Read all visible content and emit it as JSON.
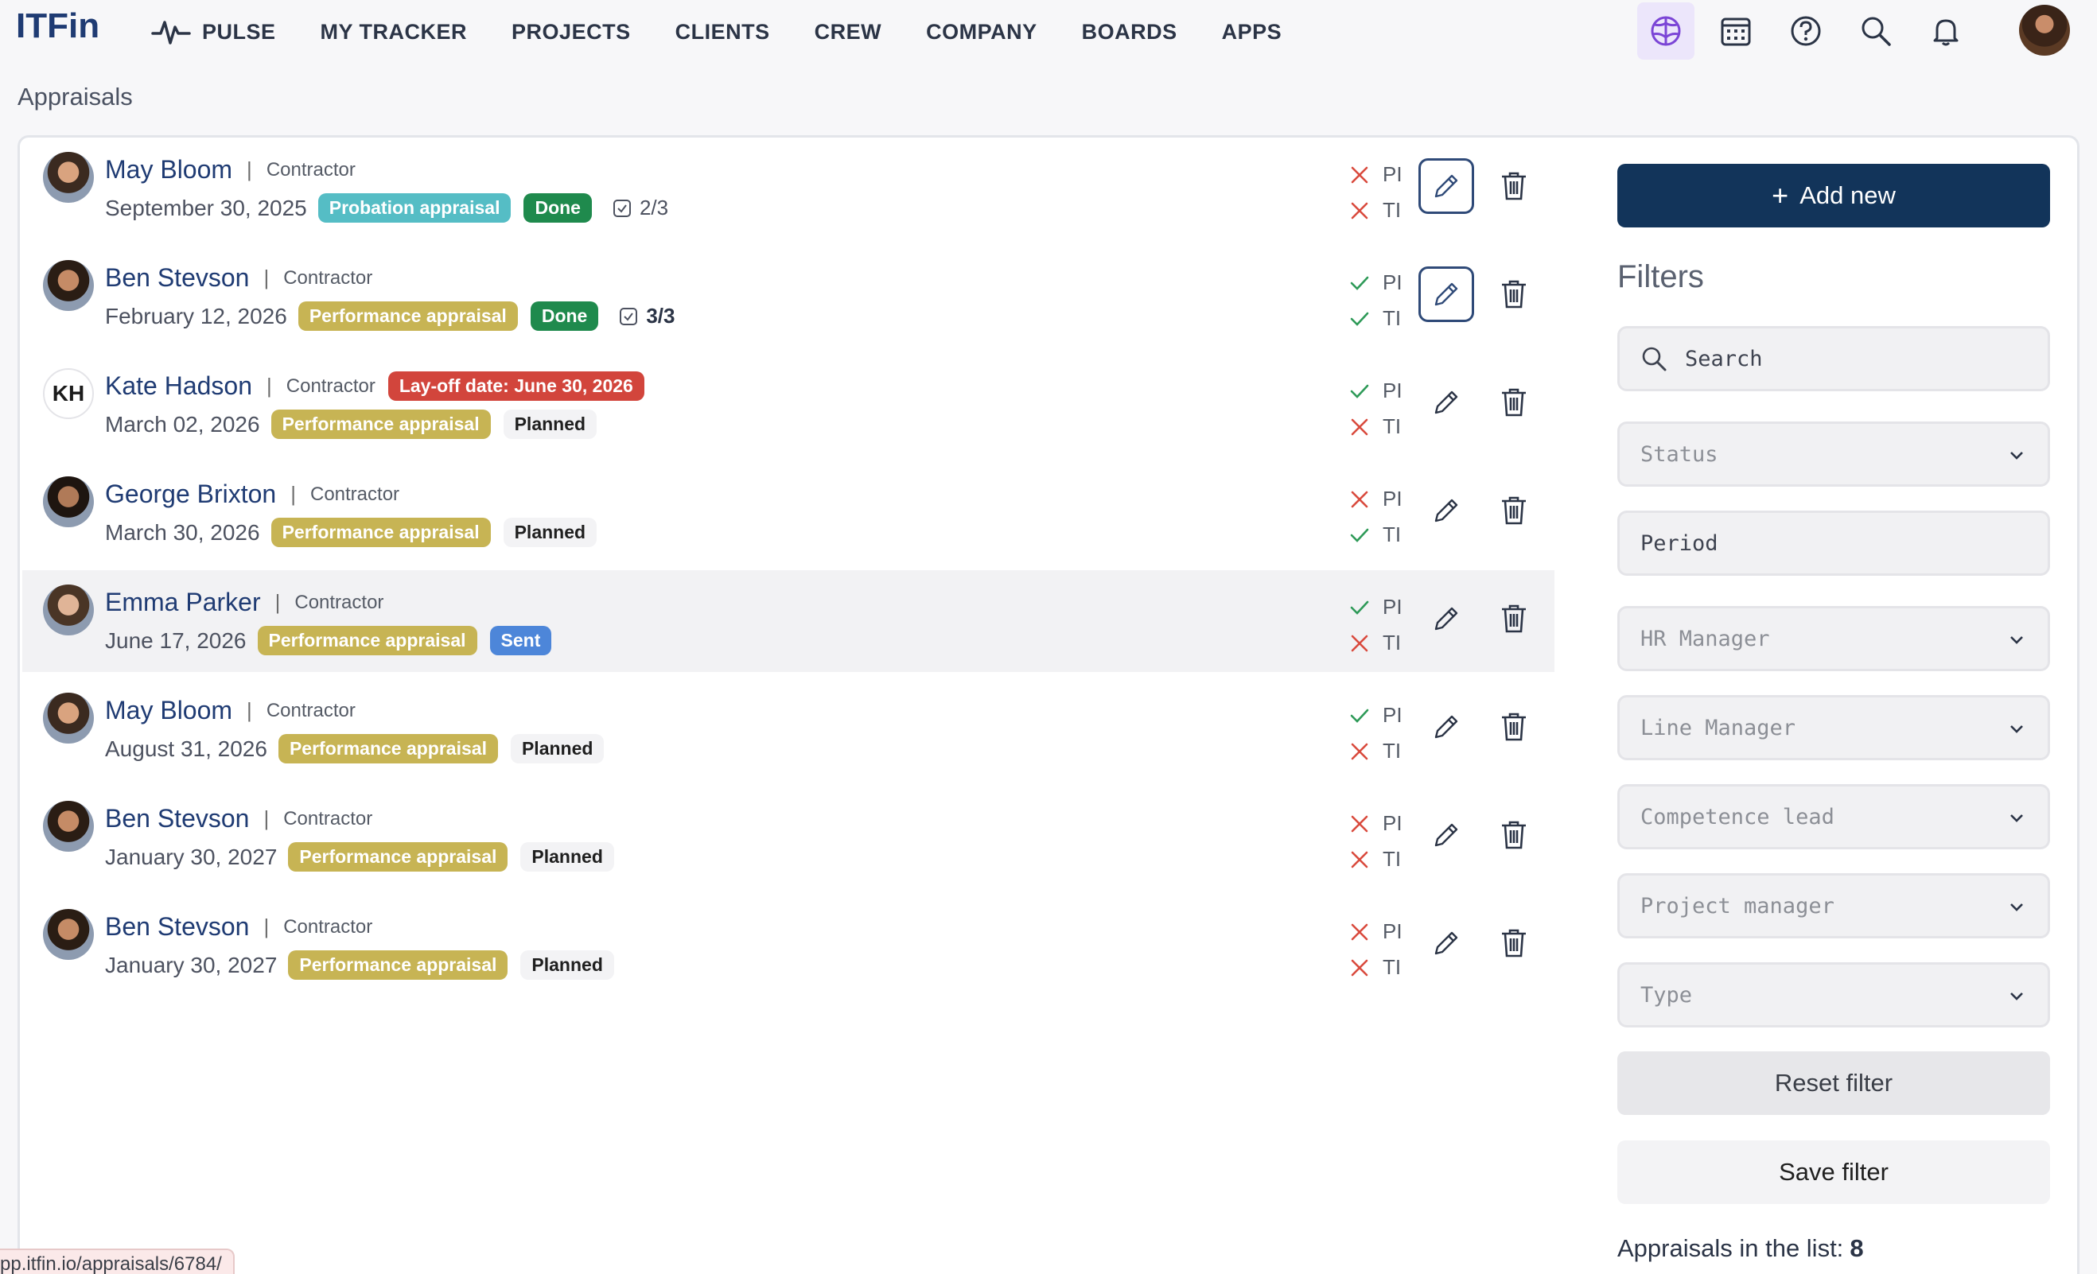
{
  "app": {
    "logo": "ITFin"
  },
  "nav": {
    "items": [
      "PULSE",
      "MY TRACKER",
      "PROJECTS",
      "CLIENTS",
      "CREW",
      "COMPANY",
      "BOARDS",
      "APPS"
    ]
  },
  "top_icons": [
    "brain-icon",
    "calendar-icon",
    "help-icon",
    "search-icon",
    "bell-icon"
  ],
  "page": {
    "title": "Appraisals"
  },
  "appraisals": [
    {
      "name": "May Bloom",
      "role": "Contractor",
      "date": "September 30, 2025",
      "type": "Probation appraisal",
      "type_color": "#55bdc5",
      "status": "Done",
      "tasks": "2/3",
      "pi": false,
      "ti": false,
      "layoff": ""
    },
    {
      "name": "Ben Stevson",
      "role": "Contractor",
      "date": "February 12, 2026",
      "type": "Performance appraisal",
      "type_color": "#c7b454",
      "status": "Done",
      "tasks": "3/3",
      "pi": true,
      "ti": true,
      "layoff": ""
    },
    {
      "name": "Kate Hadson",
      "initials": "KH",
      "role": "Contractor",
      "date": "March 02, 2026",
      "type": "Performance appraisal",
      "type_color": "#c7b454",
      "status": "Planned",
      "tasks": "",
      "pi": true,
      "ti": false,
      "layoff": "Lay-off date: June 30, 2026"
    },
    {
      "name": "George Brixton",
      "role": "Contractor",
      "date": "March 30, 2026",
      "type": "Performance appraisal",
      "type_color": "#c7b454",
      "status": "Planned",
      "tasks": "",
      "pi": false,
      "ti": true,
      "layoff": ""
    },
    {
      "name": "Emma Parker",
      "role": "Contractor",
      "date": "June 17, 2026",
      "type": "Performance appraisal",
      "type_color": "#c7b454",
      "status": "Sent",
      "tasks": "",
      "pi": true,
      "ti": false,
      "layoff": ""
    },
    {
      "name": "May Bloom",
      "role": "Contractor",
      "date": "August 31, 2026",
      "type": "Performance appraisal",
      "type_color": "#c7b454",
      "status": "Planned",
      "tasks": "",
      "pi": true,
      "ti": false,
      "layoff": ""
    },
    {
      "name": "Ben Stevson",
      "role": "Contractor",
      "date": "January 30, 2027",
      "type": "Performance appraisal",
      "type_color": "#c7b454",
      "status": "Planned",
      "tasks": "",
      "pi": false,
      "ti": false,
      "layoff": ""
    },
    {
      "name": "Ben Stevson",
      "role": "Contractor",
      "date": "January 30, 2027",
      "type": "Performance appraisal",
      "type_color": "#c7b454",
      "status": "Planned",
      "tasks": "",
      "pi": false,
      "ti": false,
      "layoff": ""
    }
  ],
  "check_labels": {
    "pi": "PI",
    "ti": "TI"
  },
  "sidebar": {
    "add_new": "Add new",
    "filters_title": "Filters",
    "search_placeholder": "Search",
    "status": "Status",
    "period": "Period",
    "hr_manager": "HR Manager",
    "line_manager": "Line Manager",
    "competence_lead": "Competence lead",
    "project_manager": "Project manager",
    "type": "Type",
    "reset": "Reset filter",
    "save": "Save filter",
    "count_label": "Appraisals in the list:",
    "count_value": "8"
  },
  "status_url": "pp.itfin.io/appraisals/6784/",
  "colors": {
    "primary": "#12345a",
    "done": "#1f8a4d",
    "sent": "#4d86d9",
    "layoff": "#d2453c",
    "check": "#2e9a58",
    "cross": "#d94a3d"
  }
}
